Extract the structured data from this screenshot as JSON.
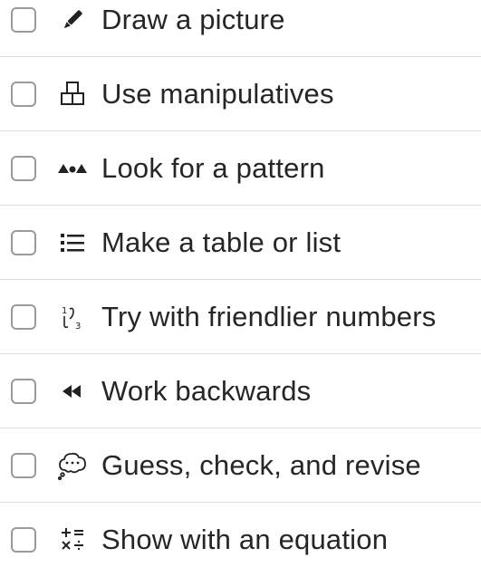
{
  "strategies": [
    {
      "label": "Draw a picture",
      "icon": "pencil-icon",
      "checked": false
    },
    {
      "label": "Use manipulatives",
      "icon": "blocks-icon",
      "checked": false
    },
    {
      "label": "Look for a pattern",
      "icon": "pattern-icon",
      "checked": false
    },
    {
      "label": "Make a table or list",
      "icon": "list-icon",
      "checked": false
    },
    {
      "label": "Try with friendlier numbers",
      "icon": "numbers-icon",
      "checked": false
    },
    {
      "label": "Work backwards",
      "icon": "rewind-icon",
      "checked": false
    },
    {
      "label": "Guess, check, and revise",
      "icon": "thought-bubble-icon",
      "checked": false
    },
    {
      "label": "Show with an equation",
      "icon": "math-operators-icon",
      "checked": false
    }
  ],
  "colors": {
    "text": "#262626",
    "checkbox_border": "#9a9a9a",
    "divider": "#dedede"
  }
}
